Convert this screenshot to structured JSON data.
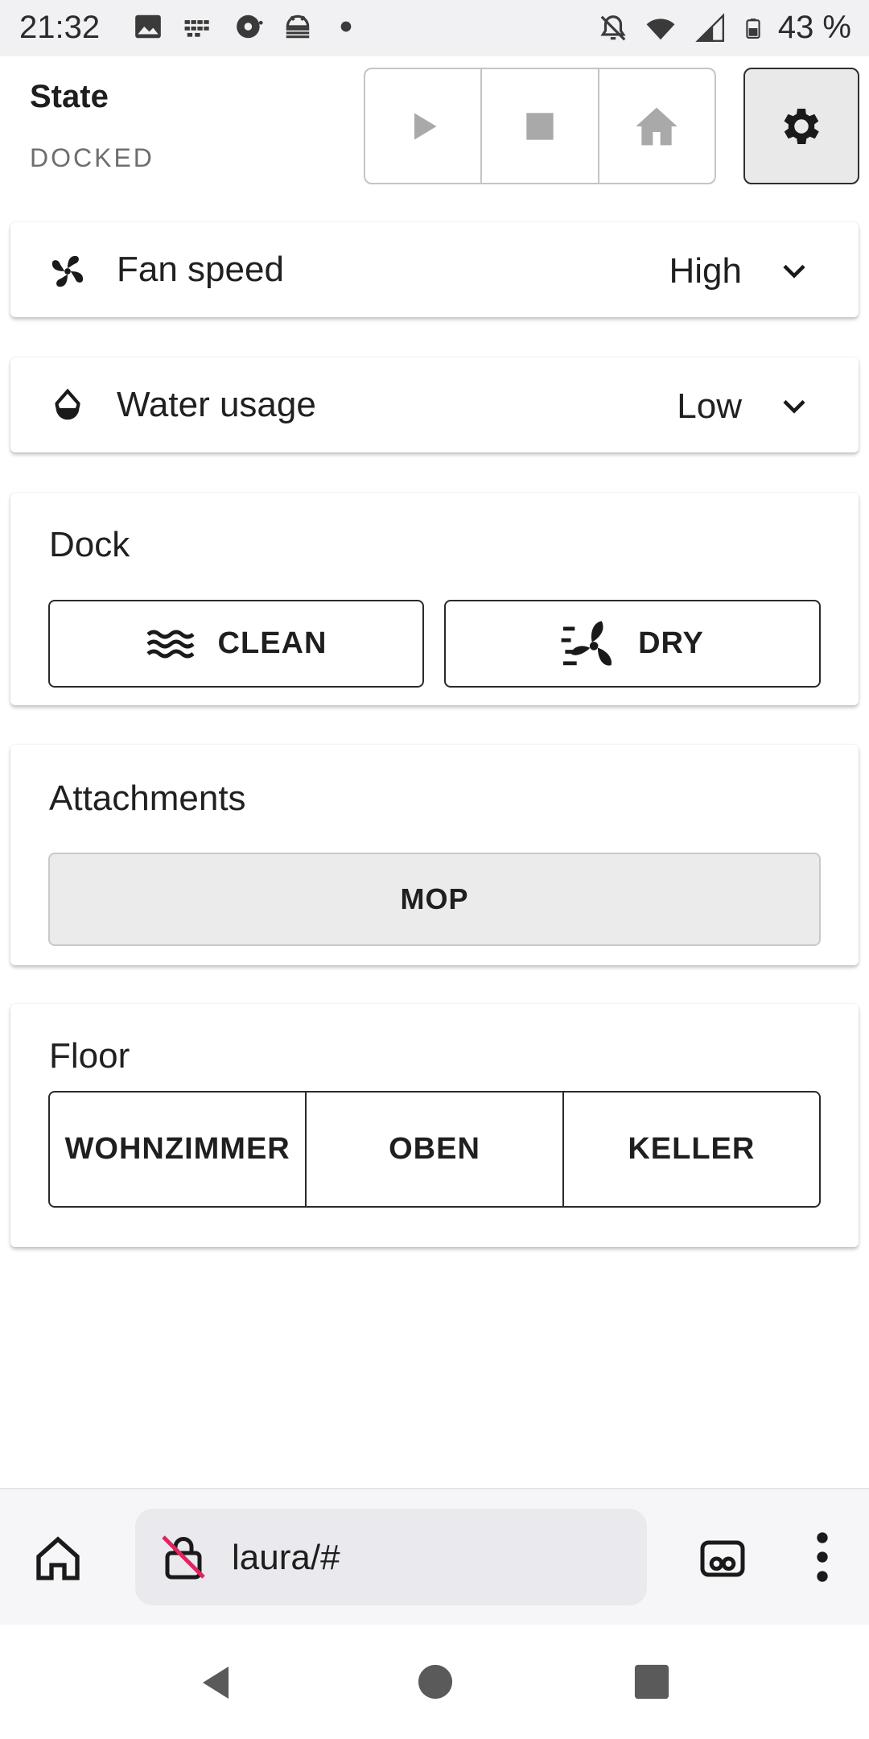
{
  "status_bar": {
    "time": "21:32",
    "battery": "43 %",
    "icons_left": [
      "image-icon",
      "vpn-grid-icon",
      "camera-icon",
      "android-debug-icon",
      "dot-icon"
    ],
    "icons_right": [
      "notifications-off-icon",
      "wifi-icon",
      "signal-icon",
      "battery-icon"
    ]
  },
  "header": {
    "state_label": "State",
    "state_value": "DOCKED",
    "controls": [
      {
        "name": "play",
        "icon": "play-icon",
        "enabled": false
      },
      {
        "name": "stop",
        "icon": "stop-icon",
        "enabled": false
      },
      {
        "name": "home",
        "icon": "home-icon",
        "enabled": false
      }
    ],
    "settings_icon": "gear-icon"
  },
  "fan_speed": {
    "icon": "fan-icon",
    "label": "Fan speed",
    "value": "High"
  },
  "water_usage": {
    "icon": "water-drop-icon",
    "label": "Water usage",
    "value": "Low"
  },
  "dock": {
    "title": "Dock",
    "clean_label": "CLEAN",
    "dry_label": "DRY"
  },
  "attachments": {
    "title": "Attachments",
    "mop_label": "MOP"
  },
  "floor": {
    "title": "Floor",
    "options": [
      "WOHNZIMMER",
      "OBEN",
      "KELLER"
    ]
  },
  "browser": {
    "url": "laura/#"
  },
  "colors": {
    "disabled_icon": "#a9a9a9",
    "accent_text": "#1f1f1f",
    "muted_text": "#6e6e6e"
  }
}
